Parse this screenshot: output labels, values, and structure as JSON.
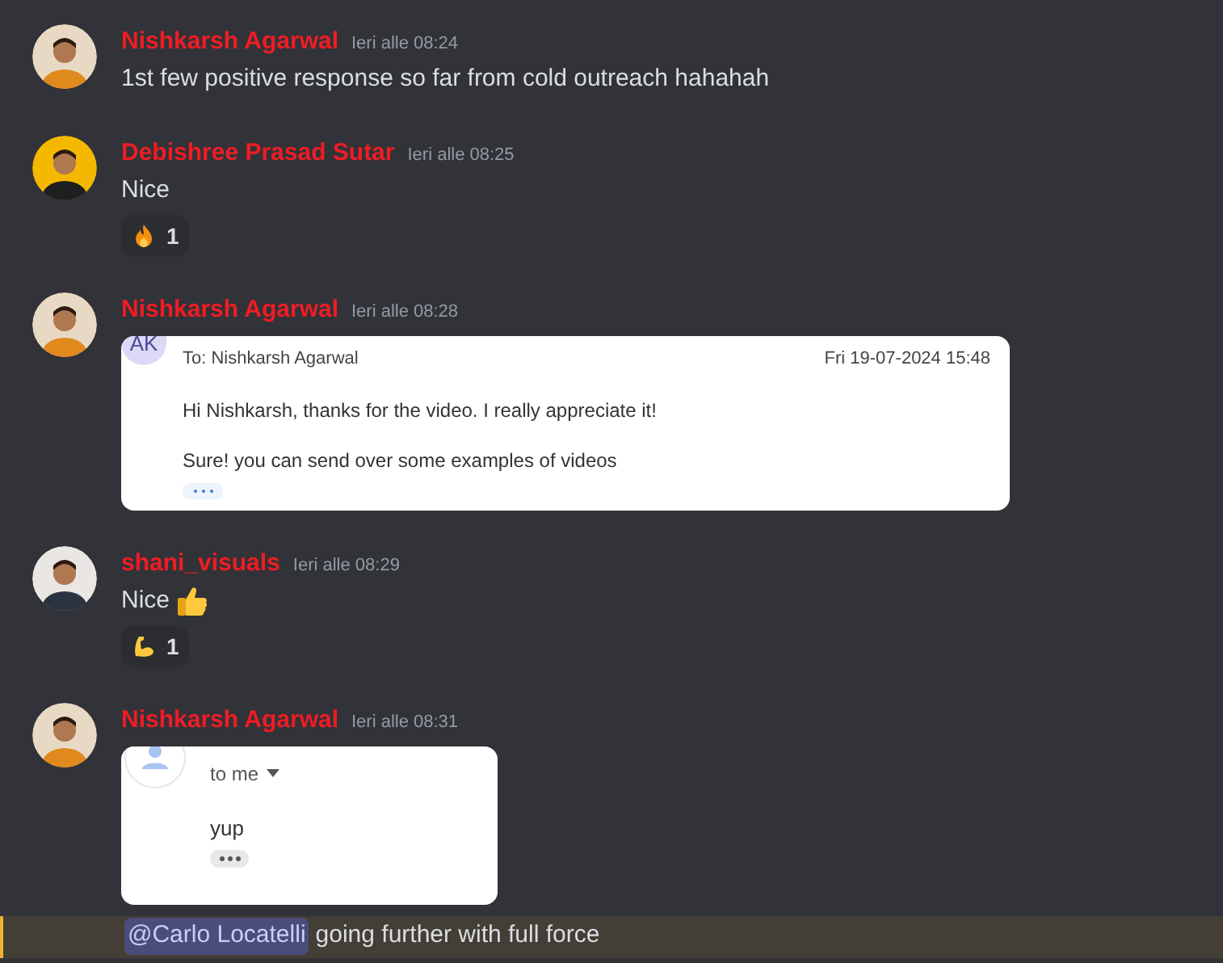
{
  "messages": [
    {
      "author": "Nishkarsh Agarwal",
      "time": "Ieri alle 08:24",
      "avatar": {
        "kind": "picture"
      },
      "body": "1st few positive response so far from cold outreach hahahah"
    },
    {
      "author": "Debishree Prasad Sutar",
      "time": "Ieri alle 08:25",
      "avatar": {
        "kind": "picture"
      },
      "body": "Nice",
      "reactions": [
        {
          "kind": "flame",
          "count": "1"
        }
      ]
    },
    {
      "author": "Nishkarsh Agarwal",
      "time": "Ieri alle 08:28",
      "avatar": {
        "kind": "picture"
      },
      "attachment": {
        "kind": "email",
        "avatar_text": "AK",
        "to": "To:  Nishkarsh Agarwal",
        "date": "Fri 19-07-2024 15:48",
        "lines": [
          "Hi Nishkarsh, thanks for the video. I really appreciate it!",
          "Sure! you can send over some examples of videos"
        ]
      }
    },
    {
      "author": "shani_visuals",
      "time": "Ieri alle 08:29",
      "avatar": {
        "kind": "picture"
      },
      "body": "Nice",
      "body_icon": {
        "kind": "thumbs_up"
      },
      "reactions": [
        {
          "kind": "flexed_arm",
          "count": "1"
        }
      ]
    },
    {
      "author": "Nishkarsh Agarwal",
      "time": "Ieri alle 08:31",
      "avatar": {
        "kind": "picture"
      },
      "attachment": {
        "kind": "reply",
        "to": "to me",
        "lines": [
          "yup"
        ]
      }
    }
  ],
  "continuation": {
    "mention": "@Carlo Locatelli",
    "text": "going further with full force",
    "highlighted": true
  }
}
